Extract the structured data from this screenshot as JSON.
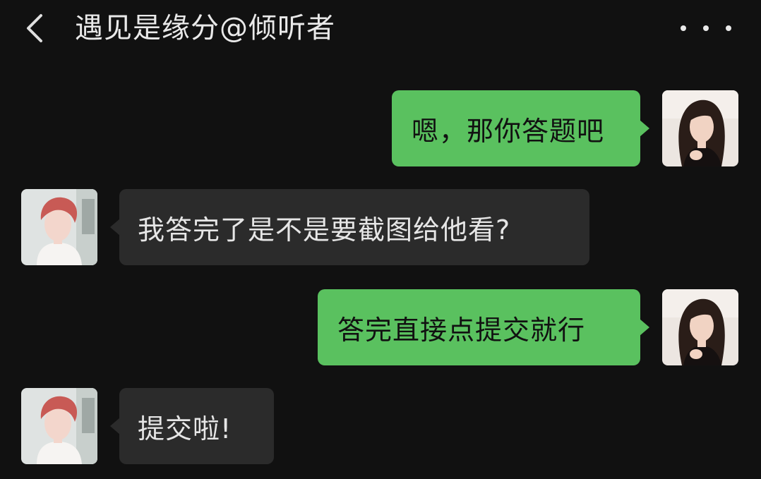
{
  "header": {
    "title": "遇见是缘分@倾听者"
  },
  "theme": {
    "background": "#111111",
    "outgoing_bubble": "#5ac15f",
    "incoming_bubble": "#2b2b2b",
    "text_light": "#e6e6e6"
  },
  "icons": {
    "back": "chevron-left-icon",
    "more": "more-dots-icon"
  },
  "messages": [
    {
      "sender": "me",
      "text": "嗯，那你答题吧"
    },
    {
      "sender": "other",
      "text": "我答完了是不是要截图给他看?"
    },
    {
      "sender": "me",
      "text": "答完直接点提交就行"
    },
    {
      "sender": "other",
      "text": "提交啦!"
    }
  ]
}
